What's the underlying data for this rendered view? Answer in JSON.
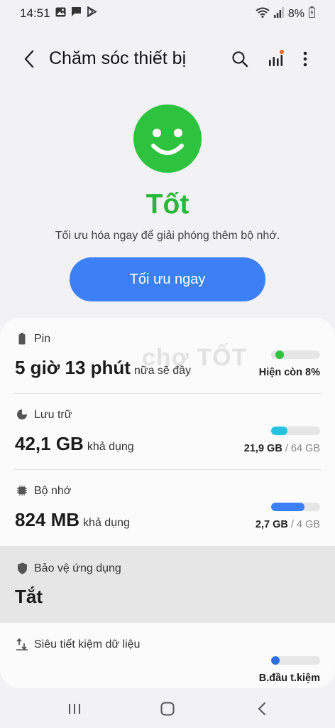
{
  "status_bar": {
    "time": "14:51",
    "battery_text": "8%",
    "left_icons": [
      "gallery-icon",
      "message-icon",
      "play-store-icon"
    ],
    "right_icons": [
      "wifi-icon",
      "signal-icon",
      "battery-icon"
    ]
  },
  "app_bar": {
    "title": "Chăm sóc thiết bị",
    "actions": [
      "search-icon",
      "stats-icon",
      "more-options-icon"
    ]
  },
  "summary": {
    "status": "Tốt",
    "message": "Tối ưu hóa ngay để giải phóng thêm bộ nhớ.",
    "optimize_button": "Tối ưu ngay",
    "status_color": "#2ec33f"
  },
  "items": {
    "battery": {
      "label": "Pin",
      "value": "5 giờ 13 phút",
      "suffix": "nữa sẽ đầy",
      "caption": "Hiện còn 8%",
      "level": 0.08,
      "color": "#2ec33f"
    },
    "storage": {
      "label": "Lưu trữ",
      "value": "42,1 GB",
      "suffix": "khả dụng",
      "used": "21,9 GB",
      "total": "/ 64 GB",
      "level": 0.34,
      "color": "#25c3e0"
    },
    "memory": {
      "label": "Bộ nhớ",
      "value": "824 MB",
      "suffix": "khả dụng",
      "used": "2,7 GB",
      "total": "/ 4 GB",
      "level": 0.675,
      "color": "#3d7ff5"
    },
    "app_protection": {
      "label": "Bảo vệ ứng dụng",
      "value": "Tắt"
    },
    "data_saver": {
      "label": "Siêu tiết kiệm dữ liệu",
      "caption": "B.đầu t.kiệm",
      "level": 0.0,
      "color": "#2e6fe0"
    }
  },
  "watermark": "chợ TỐT",
  "nav_bar": [
    "recent-apps-icon",
    "home-icon",
    "back-icon"
  ]
}
